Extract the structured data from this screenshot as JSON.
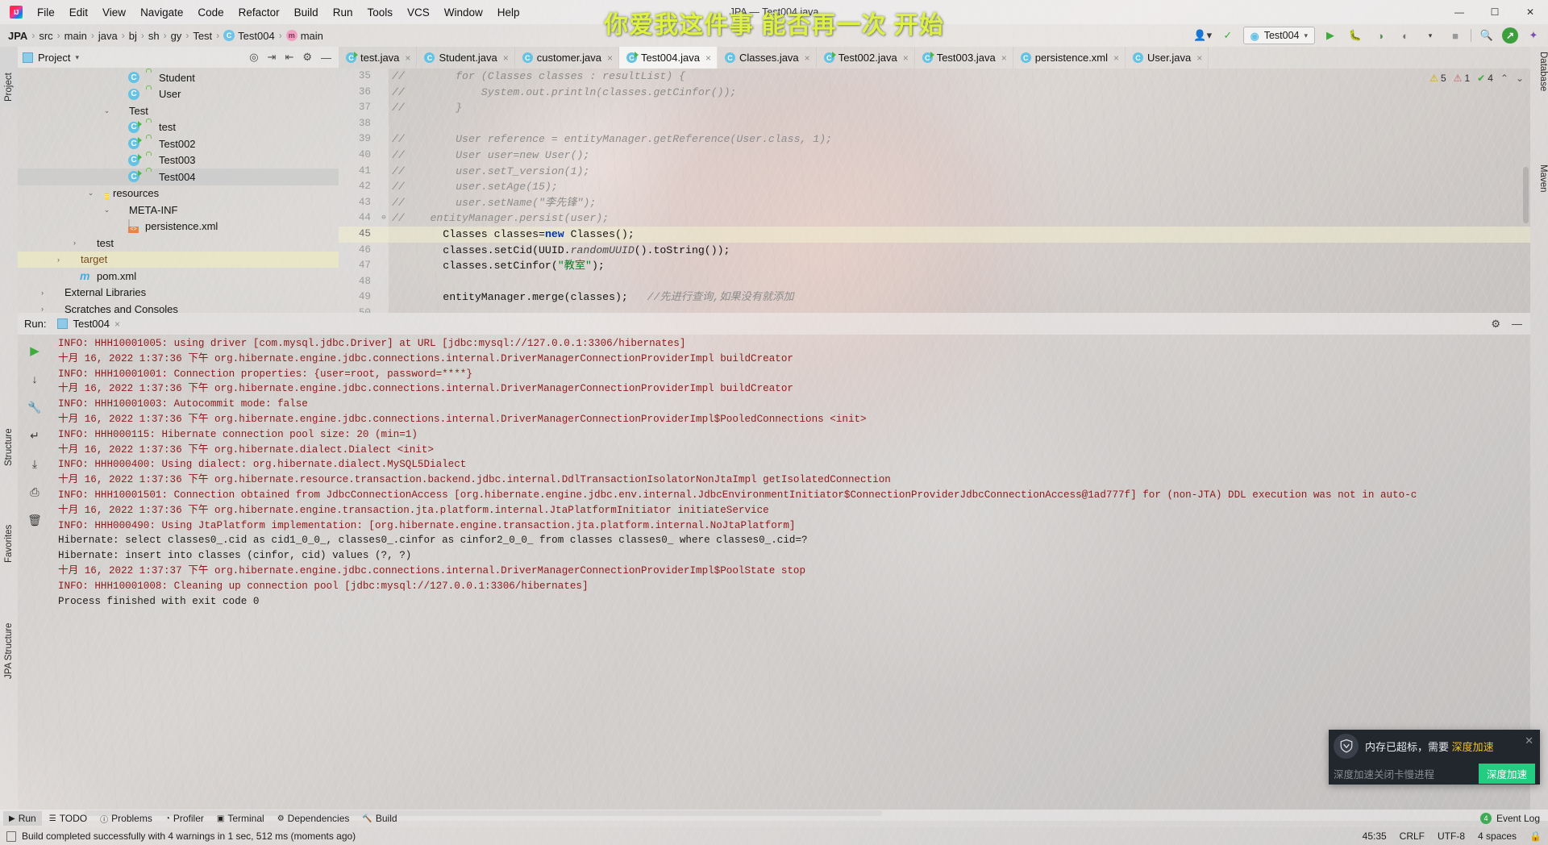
{
  "window": {
    "title": "JPA — Test004.java",
    "overlay_text": "你爱我这件事 能否再一次 开始",
    "controls": [
      "—",
      "❐",
      "✕"
    ]
  },
  "menu": [
    {
      "label": "File"
    },
    {
      "label": "Edit"
    },
    {
      "label": "View"
    },
    {
      "label": "Navigate"
    },
    {
      "label": "Code"
    },
    {
      "label": "Refactor"
    },
    {
      "label": "Build"
    },
    {
      "label": "Run"
    },
    {
      "label": "Tools"
    },
    {
      "label": "VCS"
    },
    {
      "label": "Window"
    },
    {
      "label": "Help"
    }
  ],
  "breadcrumb": [
    {
      "label": "JPA",
      "icon": "",
      "bold": true
    },
    {
      "label": "src",
      "icon": ""
    },
    {
      "label": "main",
      "icon": ""
    },
    {
      "label": "java",
      "icon": ""
    },
    {
      "label": "bj",
      "icon": ""
    },
    {
      "label": "sh",
      "icon": ""
    },
    {
      "label": "gy",
      "icon": ""
    },
    {
      "label": "Test",
      "icon": ""
    },
    {
      "label": "Test004",
      "icon": "class-icon"
    },
    {
      "label": "main",
      "icon": "method-icon"
    }
  ],
  "toolbar": {
    "run_config": "Test004",
    "run_label": "▶",
    "debug_label": "🐞",
    "coverage_label": "◷",
    "profile_label": "◔",
    "more_label": "▾",
    "stop_label": "■",
    "search_label": "🔍",
    "account_label": "✓",
    "update_label": "⬇",
    "settings_label": "⚙",
    "user_label": "👤"
  },
  "left_strip": [
    {
      "label": "Project",
      "selected": true
    },
    {
      "label": "Structure",
      "selected": false
    },
    {
      "label": "Favorites",
      "selected": false
    },
    {
      "label": "JPA Structure",
      "selected": false
    }
  ],
  "right_strip": [
    {
      "label": "Database"
    },
    {
      "label": "m"
    },
    {
      "label": "Maven"
    }
  ],
  "project_panel": {
    "title": "Project",
    "chevron": "▾",
    "actions": [
      "target-icon",
      "collapse-icon",
      "expand-icon",
      "gear-icon",
      "minimize-icon"
    ],
    "tree": [
      {
        "indent": 6,
        "twisty": "",
        "icon": "class-icon",
        "lock": true,
        "label": "Student",
        "state": ""
      },
      {
        "indent": 6,
        "twisty": "",
        "icon": "class-icon",
        "lock": true,
        "label": "User",
        "state": ""
      },
      {
        "indent": 5,
        "twisty": "⌄",
        "icon": "folder-icon",
        "lock": false,
        "label": "Test",
        "state": ""
      },
      {
        "indent": 6,
        "twisty": "",
        "icon": "runnable-class-icon",
        "lock": true,
        "label": "test",
        "state": ""
      },
      {
        "indent": 6,
        "twisty": "",
        "icon": "runnable-class-icon",
        "lock": true,
        "label": "Test002",
        "state": ""
      },
      {
        "indent": 6,
        "twisty": "",
        "icon": "runnable-class-icon",
        "lock": true,
        "label": "Test003",
        "state": ""
      },
      {
        "indent": 6,
        "twisty": "",
        "icon": "runnable-class-icon",
        "lock": true,
        "label": "Test004",
        "state": "selected"
      },
      {
        "indent": 4,
        "twisty": "⌄",
        "icon": "resources-folder-icon",
        "lock": false,
        "label": "resources",
        "state": ""
      },
      {
        "indent": 5,
        "twisty": "⌄",
        "icon": "folder-icon",
        "lock": false,
        "label": "META-INF",
        "state": ""
      },
      {
        "indent": 6,
        "twisty": "",
        "icon": "xml-file-icon",
        "lock": false,
        "label": "persistence.xml",
        "state": ""
      },
      {
        "indent": 3,
        "twisty": "›",
        "icon": "folder-icon",
        "lock": false,
        "label": "test",
        "state": ""
      },
      {
        "indent": 2,
        "twisty": "›",
        "icon": "target-folder-icon",
        "lock": false,
        "label": "target",
        "state": "highlight"
      },
      {
        "indent": 3,
        "twisty": "",
        "icon": "maven-icon",
        "lock": false,
        "label": "pom.xml",
        "state": ""
      },
      {
        "indent": 1,
        "twisty": "›",
        "icon": "library-icon",
        "lock": false,
        "label": "External Libraries",
        "state": ""
      },
      {
        "indent": 1,
        "twisty": "›",
        "icon": "scratch-icon",
        "lock": false,
        "label": "Scratches and Consoles",
        "state": ""
      }
    ]
  },
  "editor": {
    "tabs": [
      {
        "label": "test.java",
        "runnable": true,
        "active": false
      },
      {
        "label": "Student.java",
        "runnable": false,
        "active": false
      },
      {
        "label": "customer.java",
        "runnable": false,
        "active": false
      },
      {
        "label": "Test004.java",
        "runnable": true,
        "active": true
      },
      {
        "label": "Classes.java",
        "runnable": false,
        "active": false
      },
      {
        "label": "Test002.java",
        "runnable": true,
        "active": false
      },
      {
        "label": "Test003.java",
        "runnable": true,
        "active": false
      },
      {
        "label": "persistence.xml",
        "runnable": false,
        "active": false
      },
      {
        "label": "User.java",
        "runnable": false,
        "active": false
      }
    ],
    "tab_close": "×",
    "inspections": {
      "warnings": "5",
      "errors": "1",
      "typos": "4",
      "warn_icon": "⚠",
      "err_icon": "⚠",
      "ok_icon": "✔",
      "chevron_up": "⌃",
      "chevron_down": "⌄"
    },
    "lines": [
      {
        "no": "35",
        "fold": "",
        "current": false,
        "parts": [
          {
            "t": "//",
            "c": "cm"
          },
          {
            "t": "        for (Classes classes : resultList) {",
            "c": "cm"
          }
        ]
      },
      {
        "no": "36",
        "fold": "",
        "current": false,
        "parts": [
          {
            "t": "//",
            "c": "cm"
          },
          {
            "t": "            System.out.println(classes.getCinfor());",
            "c": "cm"
          }
        ]
      },
      {
        "no": "37",
        "fold": "",
        "current": false,
        "parts": [
          {
            "t": "//",
            "c": "cm"
          },
          {
            "t": "        }",
            "c": "cm"
          }
        ]
      },
      {
        "no": "38",
        "fold": "",
        "current": false,
        "parts": [
          {
            "t": "",
            "c": "pl"
          }
        ]
      },
      {
        "no": "39",
        "fold": "",
        "current": false,
        "parts": [
          {
            "t": "//",
            "c": "cm"
          },
          {
            "t": "        User reference = entityManager.getReference(User.class, 1);",
            "c": "cm"
          }
        ]
      },
      {
        "no": "40",
        "fold": "",
        "current": false,
        "parts": [
          {
            "t": "//",
            "c": "cm"
          },
          {
            "t": "        User user=new User();",
            "c": "cm"
          }
        ]
      },
      {
        "no": "41",
        "fold": "",
        "current": false,
        "parts": [
          {
            "t": "//",
            "c": "cm"
          },
          {
            "t": "        user.setT_version(1);",
            "c": "cm"
          }
        ]
      },
      {
        "no": "42",
        "fold": "",
        "current": false,
        "parts": [
          {
            "t": "//",
            "c": "cm"
          },
          {
            "t": "        user.setAge(15);",
            "c": "cm"
          }
        ]
      },
      {
        "no": "43",
        "fold": "",
        "current": false,
        "parts": [
          {
            "t": "//",
            "c": "cm"
          },
          {
            "t": "        user.setName(\"李先锋\");",
            "c": "cm"
          }
        ]
      },
      {
        "no": "44",
        "fold": "⊖",
        "current": false,
        "parts": [
          {
            "t": "//",
            "c": "cm"
          },
          {
            "t": "    entityManager.persist(user);",
            "c": "cm"
          }
        ]
      },
      {
        "no": "45",
        "fold": "",
        "current": true,
        "parts": [
          {
            "t": "        Classes classes=",
            "c": "pl"
          },
          {
            "t": "new",
            "c": "kw"
          },
          {
            "t": " Classes();",
            "c": "pl"
          }
        ]
      },
      {
        "no": "46",
        "fold": "",
        "current": false,
        "parts": [
          {
            "t": "        classes.setCid(UUID.",
            "c": "pl"
          },
          {
            "t": "randomUUID",
            "c": "sf"
          },
          {
            "t": "().toString());",
            "c": "pl"
          }
        ]
      },
      {
        "no": "47",
        "fold": "",
        "current": false,
        "parts": [
          {
            "t": "        classes.setCinfor(",
            "c": "pl"
          },
          {
            "t": "\"教室\"",
            "c": "str"
          },
          {
            "t": ");",
            "c": "pl"
          }
        ]
      },
      {
        "no": "48",
        "fold": "",
        "current": false,
        "parts": [
          {
            "t": "",
            "c": "pl"
          }
        ]
      },
      {
        "no": "49",
        "fold": "",
        "current": false,
        "parts": [
          {
            "t": "        entityManager.merge(classes);   ",
            "c": "pl"
          },
          {
            "t": "//先进行查询,如果没有就添加",
            "c": "cm"
          }
        ]
      },
      {
        "no": "50",
        "fold": "",
        "current": false,
        "parts": [
          {
            "t": "",
            "c": "pl"
          }
        ]
      }
    ]
  },
  "run_window": {
    "label": "Run:",
    "tab_label": "Test004",
    "tab_close": "×",
    "actions": [
      "gear-icon",
      "minimize-icon"
    ],
    "side_buttons": [
      {
        "name": "rerun-button",
        "glyph": "▶"
      },
      {
        "name": "scroll-down-button",
        "glyph": "↓"
      },
      {
        "name": "wrench-button",
        "glyph": "🔧"
      },
      {
        "name": "soft-wrap-button",
        "glyph": "↵"
      },
      {
        "name": "scroll-end-button",
        "glyph": "⤓"
      },
      {
        "name": "print-button",
        "glyph": "⎙"
      },
      {
        "name": "trash-button",
        "glyph": "🗑"
      }
    ],
    "console_lines": [
      {
        "text": "INFO: HHH10001005: using driver [com.mysql.jdbc.Driver] at URL [jdbc:mysql://127.0.0.1:3306/hibernates]",
        "color": "red"
      },
      {
        "text": "十月 16, 2022 1:37:36 下午 org.hibernate.engine.jdbc.connections.internal.DriverManagerConnectionProviderImpl buildCreator",
        "color": "red"
      },
      {
        "text": "INFO: HHH10001001: Connection properties: {user=root, password=****}",
        "color": "red"
      },
      {
        "text": "十月 16, 2022 1:37:36 下午 org.hibernate.engine.jdbc.connections.internal.DriverManagerConnectionProviderImpl buildCreator",
        "color": "red"
      },
      {
        "text": "INFO: HHH10001003: Autocommit mode: false",
        "color": "red"
      },
      {
        "text": "十月 16, 2022 1:37:36 下午 org.hibernate.engine.jdbc.connections.internal.DriverManagerConnectionProviderImpl$PooledConnections <init>",
        "color": "red"
      },
      {
        "text": "INFO: HHH000115: Hibernate connection pool size: 20 (min=1)",
        "color": "red"
      },
      {
        "text": "十月 16, 2022 1:37:36 下午 org.hibernate.dialect.Dialect <init>",
        "color": "red"
      },
      {
        "text": "INFO: HHH000400: Using dialect: org.hibernate.dialect.MySQL5Dialect",
        "color": "red"
      },
      {
        "text": "十月 16, 2022 1:37:36 下午 org.hibernate.resource.transaction.backend.jdbc.internal.DdlTransactionIsolatorNonJtaImpl getIsolatedConnection",
        "color": "red"
      },
      {
        "text": "INFO: HHH10001501: Connection obtained from JdbcConnectionAccess [org.hibernate.engine.jdbc.env.internal.JdbcEnvironmentInitiator$ConnectionProviderJdbcConnectionAccess@1ad777f] for (non-JTA) DDL execution was not in auto-c",
        "color": "red"
      },
      {
        "text": "十月 16, 2022 1:37:36 下午 org.hibernate.engine.transaction.jta.platform.internal.JtaPlatformInitiator initiateService",
        "color": "red"
      },
      {
        "text": "INFO: HHH000490: Using JtaPlatform implementation: [org.hibernate.engine.transaction.jta.platform.internal.NoJtaPlatform]",
        "color": "red"
      },
      {
        "text": "Hibernate: select classes0_.cid as cid1_0_0_, classes0_.cinfor as cinfor2_0_0_ from classes classes0_ where classes0_.cid=?",
        "color": "black"
      },
      {
        "text": "Hibernate: insert into classes (cinfor, cid) values (?, ?)",
        "color": "black"
      },
      {
        "text": "十月 16, 2022 1:37:37 下午 org.hibernate.engine.jdbc.connections.internal.DriverManagerConnectionProviderImpl$PoolState stop",
        "color": "red"
      },
      {
        "text": "INFO: HHH10001008: Cleaning up connection pool [jdbc:mysql://127.0.0.1:3306/hibernates]",
        "color": "red"
      },
      {
        "text": "",
        "color": "black"
      },
      {
        "text": "Process finished with exit code 0",
        "color": "black"
      }
    ]
  },
  "bottom_bar": {
    "items": [
      {
        "label": "Run",
        "icon": "▶",
        "selected": true
      },
      {
        "label": "TODO",
        "icon": "☰",
        "selected": false
      },
      {
        "label": "Problems",
        "icon": "ⓘ",
        "selected": false
      },
      {
        "label": "Profiler",
        "icon": "◔",
        "selected": false
      },
      {
        "label": "Terminal",
        "icon": "▣",
        "selected": false
      },
      {
        "label": "Dependencies",
        "icon": "⚙",
        "selected": false
      },
      {
        "label": "Build",
        "icon": "🔨",
        "selected": false
      }
    ],
    "event_log": {
      "label": "Event Log",
      "count": "4"
    }
  },
  "status_bar": {
    "message": "Build completed successfully with 4 warnings in 1 sec, 512 ms (moments ago)",
    "caret": "45:35",
    "line_sep": "CRLF",
    "encoding": "UTF-8",
    "indent": "4 spaces",
    "lock": "🔒"
  },
  "toast": {
    "title_prefix": "内存已超标，需要 ",
    "title_accent": "深度加速",
    "subtitle": "深度加速关闭卡慢进程",
    "button": "深度加速",
    "close": "✕"
  },
  "colors": {
    "accent_green": "#23cc81",
    "toast_bg": "#22272e",
    "toast_accent": "#f0c02a",
    "console_red": "#8b1a1a",
    "keyword_blue": "#0033b3",
    "string_green": "#0a7d28",
    "overlay_yellow": "#dff045"
  }
}
